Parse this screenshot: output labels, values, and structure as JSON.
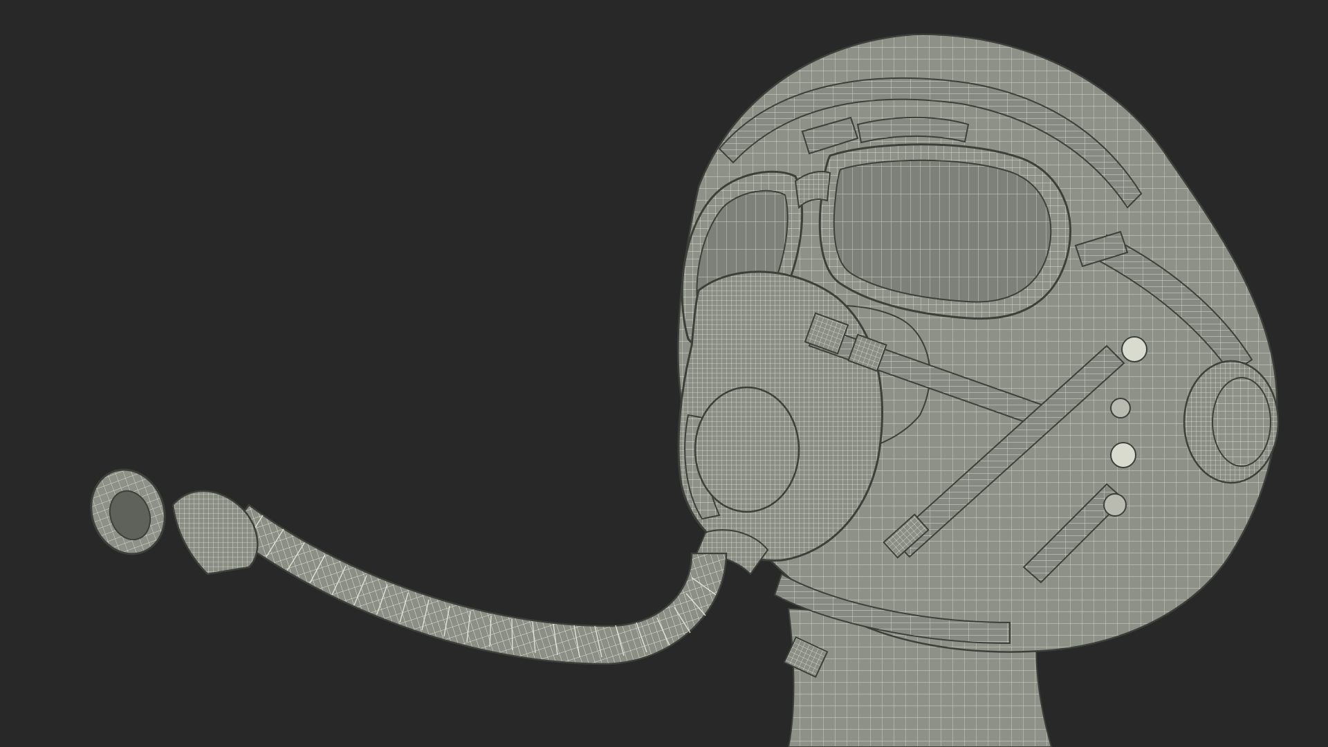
{
  "scene": {
    "subject": "pilot-helmet-with-goggles-and-oxygen-mask",
    "render_style": "wireframe",
    "colors": {
      "background": "#282828",
      "surface": "#8e9188",
      "surface_light": "#a9aca2",
      "surface_dark": "#6f726a",
      "wire": "#e9ebdf",
      "wire_dim": "#c9cbbe",
      "outline": "#3d3f3a"
    },
    "icons": {
      "helmet": "helmet-icon",
      "goggles": "goggles-icon",
      "mask": "oxygen-mask-icon",
      "hose": "hose-icon"
    }
  }
}
